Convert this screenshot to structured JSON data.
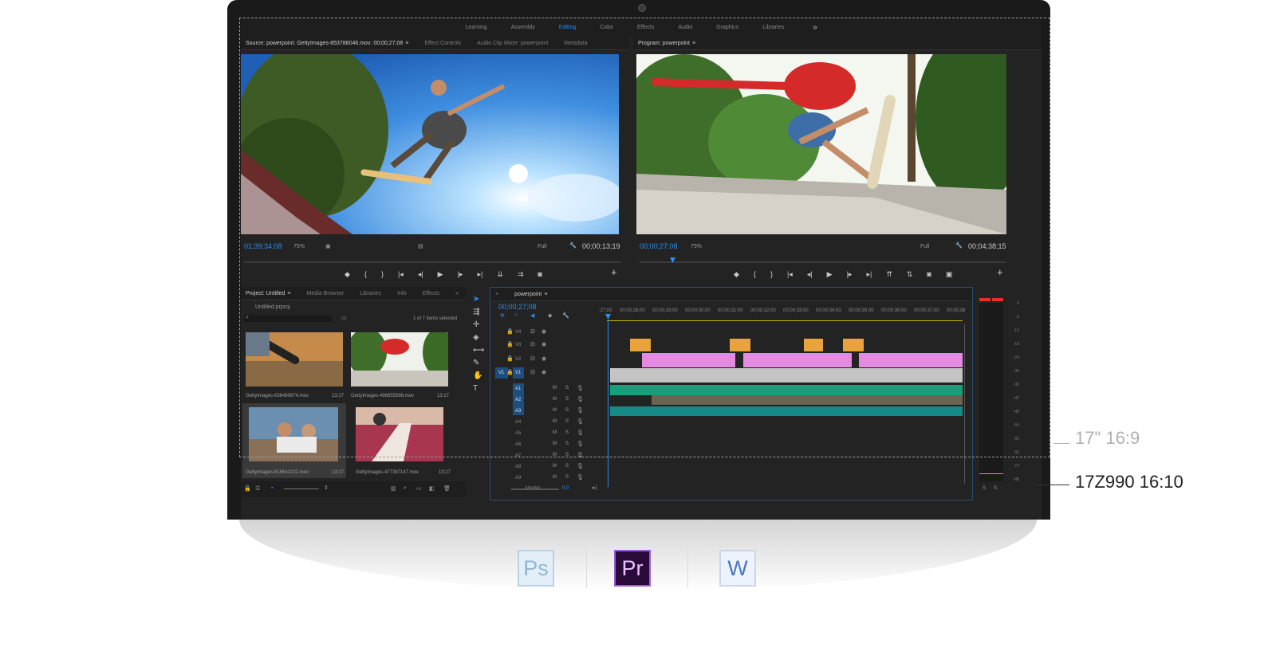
{
  "workspaces": {
    "items": [
      "Learning",
      "Assembly",
      "Editing",
      "Color",
      "Effects",
      "Audio",
      "Graphics",
      "Libraries"
    ],
    "active": "Editing",
    "more": "»"
  },
  "source": {
    "tabs": [
      "Source: powerpoint: GettyImages-853788046.mov: 00;00;27;08",
      "Effect Controls",
      "Audio Clip Mixer: powerpoint",
      "Metadata"
    ],
    "timecode": "01;39;34;08",
    "zoom": "75%",
    "resolution": "Full",
    "duration": "00;00;13;19"
  },
  "program": {
    "tab": "Program: powerpoint",
    "timecode": "00;00;27;08",
    "zoom": "75%",
    "resolution": "Full",
    "duration": "00;04;38;15"
  },
  "project": {
    "tabs": [
      "Project: Untitled",
      "Media Browser",
      "Libraries",
      "Info",
      "Effects"
    ],
    "file": "Untitled.prproj",
    "selected": "1 of 7 items selected",
    "items": [
      {
        "name": "GettyImages-638490674.mov",
        "dur": "13;17"
      },
      {
        "name": "GettyImages-498655586.mov",
        "dur": "13;17"
      },
      {
        "name": "GettyImages-819641022.mov",
        "dur": "13;17"
      },
      {
        "name": "GettyImages-477387147.mov",
        "dur": "13;17"
      }
    ]
  },
  "timeline": {
    "tab": "powerpoint",
    "timecode": "00;00;27;08",
    "ruler": [
      ";27;00",
      "00;00;28;00",
      "00;00;29;00",
      "00;00;30;00",
      "00;00;31;00",
      "00;00;32;00",
      "00;00;33;00",
      "00;00;34;00",
      "00;00;35;00",
      "00;00;36;00",
      "00;00;37;00",
      "00;00;38"
    ],
    "video_tracks": [
      "V4",
      "V3",
      "V2",
      "V1"
    ],
    "audio_tracks": [
      "A1",
      "A2",
      "A3",
      "A4",
      "A5",
      "A6",
      "A7",
      "A8",
      "A9"
    ],
    "source_patch": "V1",
    "master": "Master",
    "master_val": "0.0",
    "m": "M",
    "s": "S"
  },
  "meter": {
    "scale": [
      "0",
      "-6",
      "-12",
      "-18",
      "-24",
      "-30",
      "-36",
      "-42",
      "-48",
      "-54",
      "-60",
      "-66",
      "-72",
      "-dB"
    ],
    "solo": [
      "S",
      "S"
    ]
  },
  "annotations": {
    "label_169": "17\" 16:9",
    "label_1610": "17Z990 16:10"
  },
  "apps": {
    "ps": "Ps",
    "pr": "Pr",
    "word": "W"
  },
  "colors": {
    "accent": "#2d8ceb",
    "clip_orange": "#e8a33c",
    "clip_pink": "#e38be0",
    "clip_gray": "#c4c4c4",
    "audio_green": "#1a9e7a",
    "ps_blue": "#8fb8d6",
    "pr_purple": "#2a0a39",
    "word_blue": "#4a78c0"
  }
}
